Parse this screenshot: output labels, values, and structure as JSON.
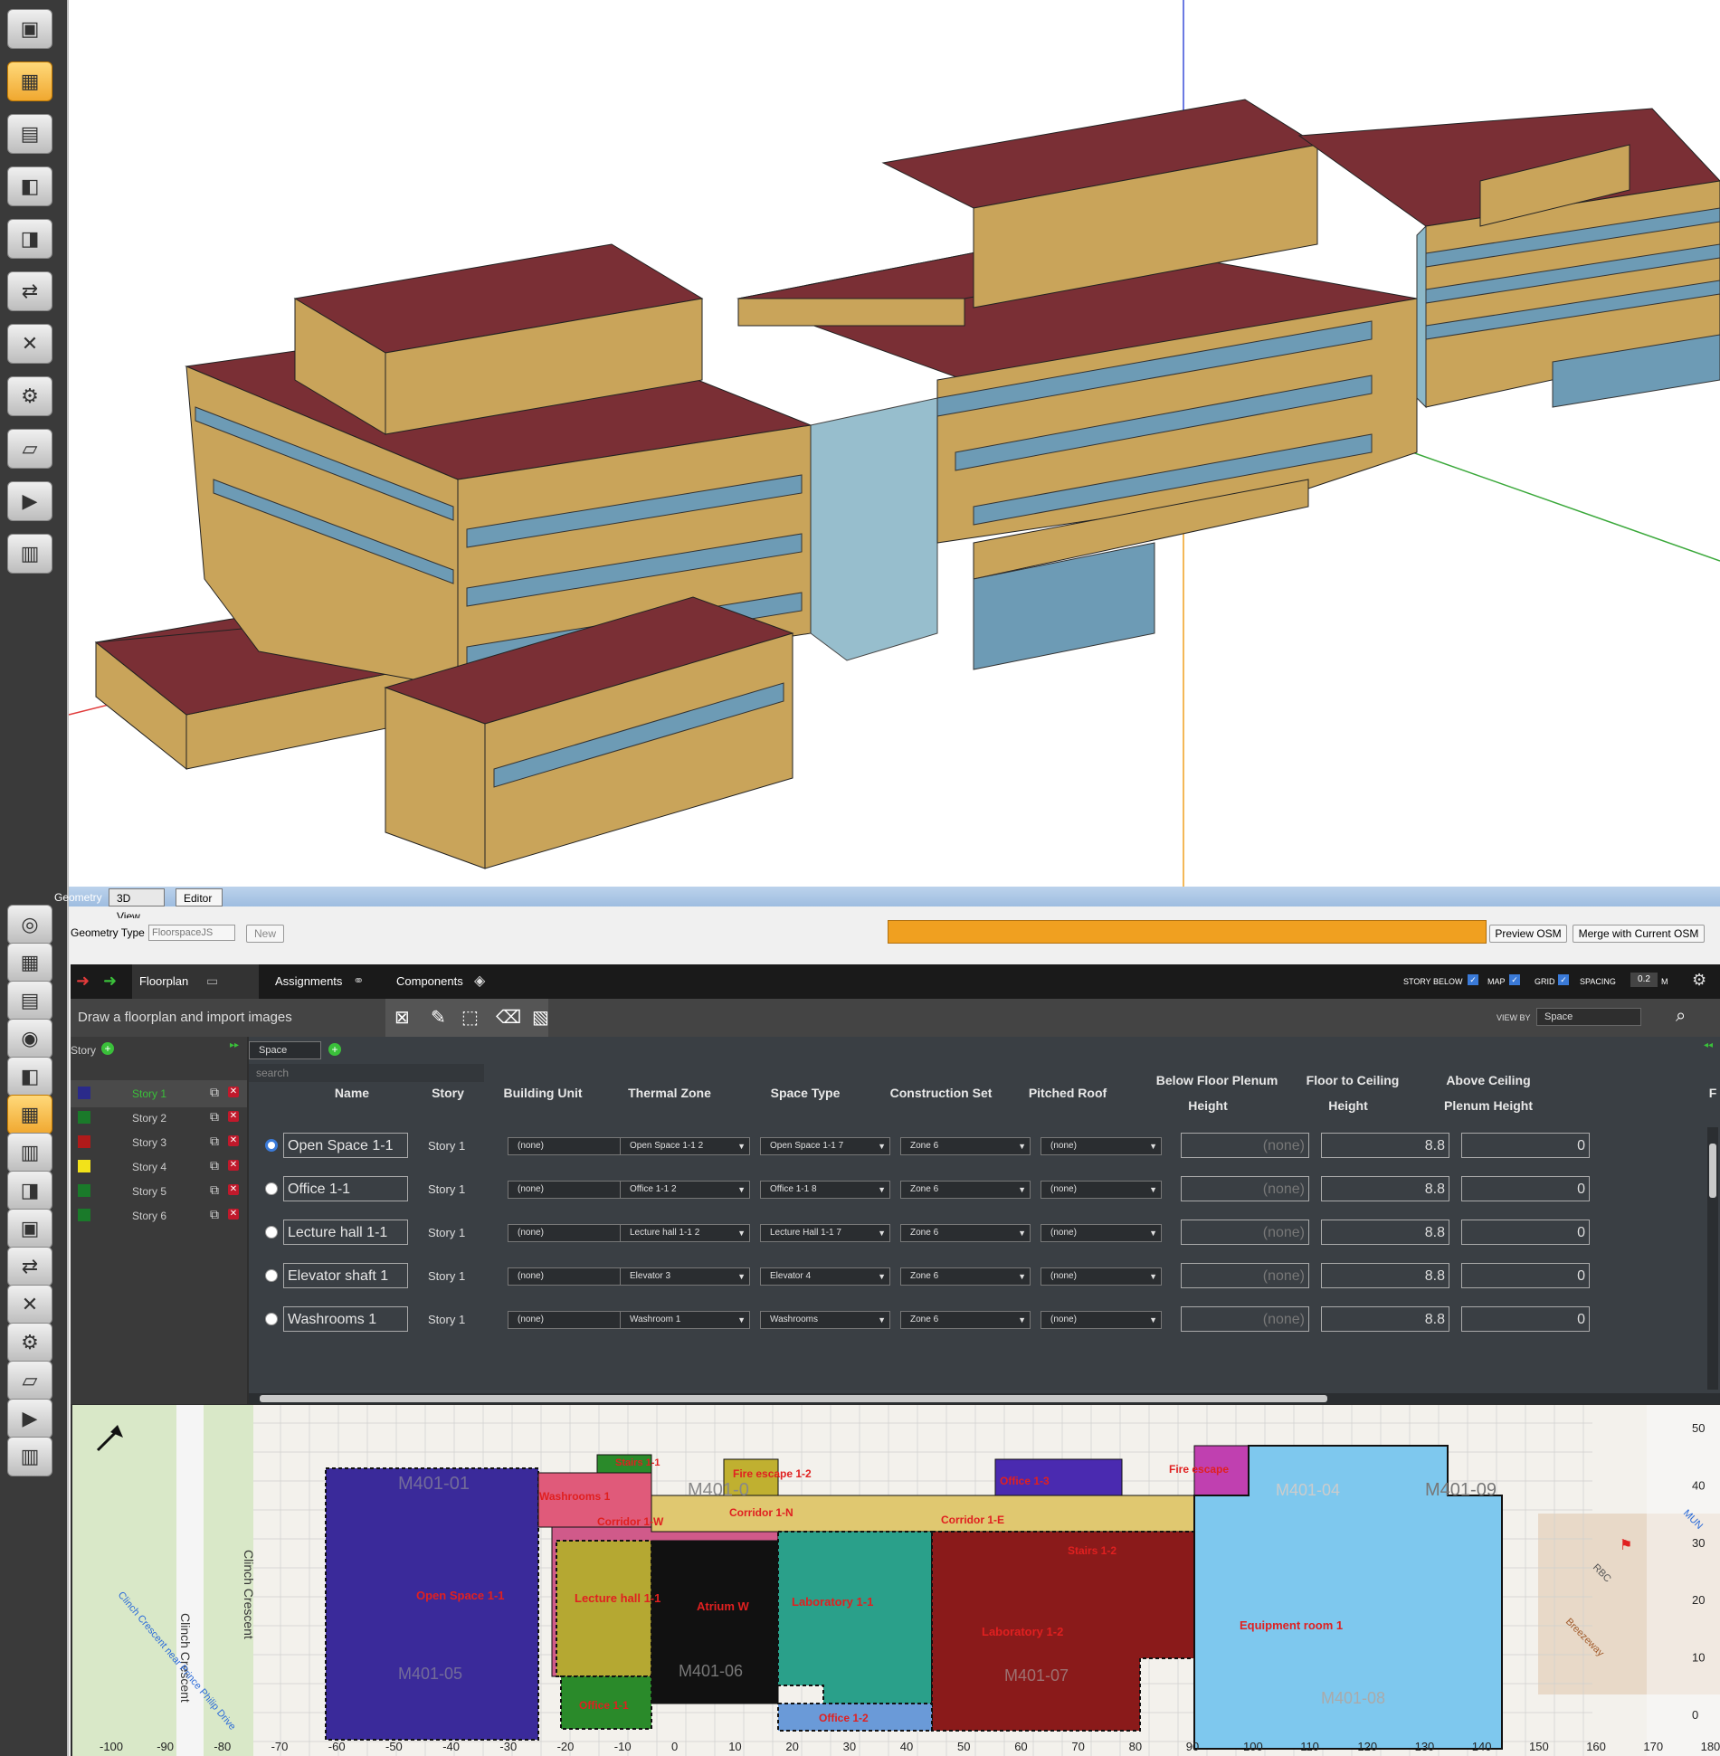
{
  "sidebar_top_icons": [
    "building-icon",
    "floorplan-icon",
    "constructions-icon",
    "loads-icon",
    "space-types-icon",
    "schedules-icon",
    "measures-icon",
    "run-icon",
    "results-icon",
    "apply-measures-icon",
    "chart-icon"
  ],
  "sidebar_bottom_icons": [
    "globe-icon",
    "schedules-icon",
    "constructions-icon",
    "loads-icon",
    "space-types-icon",
    "geometry-icon",
    "facility-icon",
    "spaces-icon",
    "thermal-zones-icon",
    "hvac-icon",
    "output-icon",
    "simulation-icon",
    "measures-icon",
    "run-icon",
    "results-icon"
  ],
  "tabs": {
    "section_label": "Geometry",
    "view3d": "3D View",
    "editor": "Editor"
  },
  "geometry_type": {
    "label": "Geometry Type",
    "value": "FloorspaceJS",
    "new_button": "New",
    "preview_button": "Preview OSM",
    "merge_button": "Merge with Current OSM",
    "progress_color": "#f0a020"
  },
  "navbar": {
    "floorplan": "Floorplan",
    "assignments": "Assignments",
    "components": "Components",
    "story_below": "STORY BELOW",
    "map": "MAP",
    "grid": "GRID",
    "spacing": "SPACING",
    "spacing_value": "0.2",
    "spacing_unit": "M"
  },
  "toolbar": {
    "title": "Draw a floorplan and import images",
    "view_by_label": "VIEW BY",
    "view_by_value": "Space"
  },
  "story_panel": {
    "header": "Story",
    "mode_select": "Space",
    "search_placeholder": "search"
  },
  "stories": [
    {
      "name": "Story 1",
      "color": "#2a2a8a",
      "active": true
    },
    {
      "name": "Story 2",
      "color": "#1a7a2a"
    },
    {
      "name": "Story 3",
      "color": "#b01a1a"
    },
    {
      "name": "Story 4",
      "color": "#f2e21a"
    },
    {
      "name": "Story 5",
      "color": "#1a7a2a"
    },
    {
      "name": "Story 6",
      "color": "#1a7a2a"
    }
  ],
  "table": {
    "headers": [
      "Name",
      "Story",
      "Building Unit",
      "Thermal Zone",
      "Space Type",
      "Construction Set",
      "Pitched Roof",
      "Below Floor Plenum",
      "Height",
      "Floor to Ceiling",
      "Height",
      "Above Ceiling",
      "Plenum Height",
      "F"
    ],
    "rows": [
      {
        "name": "Open Space 1-1",
        "story": "Story 1",
        "building_unit": "(none)",
        "thermal_zone": "Open Space 1-1 2",
        "space_type": "Open Space 1-1 7",
        "construction_set": "Zone 6",
        "pitched_roof": "(none)",
        "below_plenum": "(none)",
        "floor_to_ceiling": "8.8",
        "above_plenum": "0",
        "selected": true
      },
      {
        "name": "Office 1-1",
        "story": "Story 1",
        "building_unit": "(none)",
        "thermal_zone": "Office 1-1 2",
        "space_type": "Office 1-1 8",
        "construction_set": "Zone 6",
        "pitched_roof": "(none)",
        "below_plenum": "(none)",
        "floor_to_ceiling": "8.8",
        "above_plenum": "0"
      },
      {
        "name": "Lecture hall 1-1",
        "story": "Story 1",
        "building_unit": "(none)",
        "thermal_zone": "Lecture hall 1-1 2",
        "space_type": "Lecture Hall 1-1 7",
        "construction_set": "Zone 6",
        "pitched_roof": "(none)",
        "below_plenum": "(none)",
        "floor_to_ceiling": "8.8",
        "above_plenum": "0"
      },
      {
        "name": "Elevator shaft 1",
        "story": "Story 1",
        "building_unit": "(none)",
        "thermal_zone": "Elevator 3",
        "space_type": "Elevator 4",
        "construction_set": "Zone 6",
        "pitched_roof": "(none)",
        "below_plenum": "(none)",
        "floor_to_ceiling": "8.8",
        "above_plenum": "0"
      },
      {
        "name": "Washrooms 1",
        "story": "Story 1",
        "building_unit": "(none)",
        "thermal_zone": "Washroom 1",
        "space_type": "Washrooms",
        "construction_set": "Zone 6",
        "pitched_roof": "(none)",
        "below_plenum": "(none)",
        "floor_to_ceiling": "8.8",
        "above_plenum": "0"
      }
    ]
  },
  "floorplan": {
    "spaces": [
      {
        "label": "Open Space 1-1",
        "color": "#3a2a9a"
      },
      {
        "label": "Washrooms 1",
        "color": "#e05a7a"
      },
      {
        "label": "Lecture hall 1-1",
        "color": "#b5a832"
      },
      {
        "label": "Atrium W",
        "color": "#111111"
      },
      {
        "label": "Laboratory 1-1",
        "color": "#2aa08a"
      },
      {
        "label": "Laboratory 1-2",
        "color": "#8a1a1a"
      },
      {
        "label": "Equipment room 1",
        "color": "#7ec8ee"
      },
      {
        "label": "Office 1-1",
        "color": "#2a8a2a"
      },
      {
        "label": "Office 1-2",
        "color": "#6a9ad8"
      },
      {
        "label": "Office 1-3",
        "color": "#4a2ab0"
      },
      {
        "label": "Corridor 1-W",
        "color": "#d05a8a"
      },
      {
        "label": "Corridor 1-N",
        "color": "#e0c870"
      },
      {
        "label": "Corridor 1-E",
        "color": "#e0c870"
      },
      {
        "label": "Fire escape 1-2",
        "color": "#c0b030"
      },
      {
        "label": "Fire escape",
        "color": "#c040b0"
      },
      {
        "label": "Stairs 1-2",
        "color": "#8a1a1a"
      },
      {
        "label": "Stairs 1-1",
        "color": "#2a8a2a"
      }
    ],
    "background_labels": [
      "M401-01",
      "M401-0",
      "M401-09",
      "M401-04",
      "M401-05",
      "M401-06",
      "M401-07",
      "M401-08",
      "Clinch Crescent",
      "Clinch Crescent",
      "Clinch Crescent near Prince Philip Drive",
      "RBC",
      "Breezeway",
      "MUN"
    ],
    "x_ticks": [
      "-100",
      "-90",
      "-80",
      "-70",
      "-60",
      "-50",
      "-40",
      "-30",
      "-20",
      "-10",
      "0",
      "10",
      "20",
      "30",
      "40",
      "50",
      "60",
      "70",
      "80",
      "90",
      "100",
      "110",
      "120",
      "130",
      "140",
      "150",
      "160",
      "170",
      "180"
    ],
    "y_ticks": [
      "50",
      "40",
      "30",
      "20",
      "10",
      "0"
    ]
  }
}
